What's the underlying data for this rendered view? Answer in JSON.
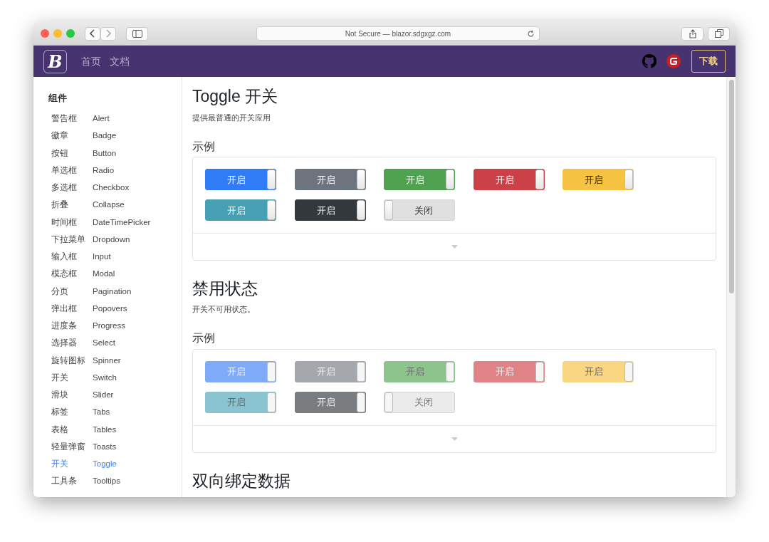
{
  "browser": {
    "address": "Not Secure — blazor.sdgxgz.com"
  },
  "navbar": {
    "logo": "B",
    "links": [
      "首页",
      "文档"
    ],
    "download": "下载"
  },
  "sidebar": {
    "heading": "组件",
    "items": [
      {
        "zh": "警告框",
        "en": "Alert",
        "selected": false
      },
      {
        "zh": "徽章",
        "en": "Badge",
        "selected": false
      },
      {
        "zh": "按钮",
        "en": "Button",
        "selected": false
      },
      {
        "zh": "单选框",
        "en": "Radio",
        "selected": false
      },
      {
        "zh": "多选框",
        "en": "Checkbox",
        "selected": false
      },
      {
        "zh": "折叠",
        "en": "Collapse",
        "selected": false
      },
      {
        "zh": "时间框",
        "en": "DateTimePicker",
        "selected": false
      },
      {
        "zh": "下拉菜单",
        "en": "Dropdown",
        "selected": false
      },
      {
        "zh": "输入框",
        "en": "Input",
        "selected": false
      },
      {
        "zh": "模态框",
        "en": "Modal",
        "selected": false
      },
      {
        "zh": "分页",
        "en": "Pagination",
        "selected": false
      },
      {
        "zh": "弹出框",
        "en": "Popovers",
        "selected": false
      },
      {
        "zh": "进度条",
        "en": "Progress",
        "selected": false
      },
      {
        "zh": "选择器",
        "en": "Select",
        "selected": false
      },
      {
        "zh": "旋转图标",
        "en": "Spinner",
        "selected": false
      },
      {
        "zh": "开关",
        "en": "Switch",
        "selected": false
      },
      {
        "zh": "滑块",
        "en": "Slider",
        "selected": false
      },
      {
        "zh": "标签",
        "en": "Tabs",
        "selected": false
      },
      {
        "zh": "表格",
        "en": "Tables",
        "selected": false
      },
      {
        "zh": "轻量弹窗",
        "en": "Toasts",
        "selected": false
      },
      {
        "zh": "开关",
        "en": "Toggle",
        "selected": true
      },
      {
        "zh": "工具条",
        "en": "Tooltips",
        "selected": false
      }
    ]
  },
  "page": {
    "title": "Toggle 开关",
    "description": "提供最普通的开关应用"
  },
  "sections": [
    {
      "example_label": "示例",
      "toggles": [
        {
          "label": "开启",
          "on": true,
          "disabled": false,
          "color": "#307bf6"
        },
        {
          "label": "开启",
          "on": true,
          "disabled": false,
          "color": "#6c757d"
        },
        {
          "label": "开启",
          "on": true,
          "disabled": false,
          "color": "#4fa24f"
        },
        {
          "label": "开启",
          "on": true,
          "disabled": false,
          "color": "#cc4148"
        },
        {
          "label": "开启",
          "on": true,
          "disabled": false,
          "color": "#f5c242"
        },
        {
          "label": "开启",
          "on": true,
          "disabled": false,
          "color": "#47a0b4"
        },
        {
          "label": "开启",
          "on": true,
          "disabled": false,
          "color": "#33383c"
        },
        {
          "label": "关闭",
          "on": false,
          "disabled": false
        }
      ]
    },
    {
      "title": "禁用状态",
      "description": "开关不可用状态。",
      "example_label": "示例",
      "toggles": [
        {
          "label": "开启",
          "on": true,
          "disabled": true,
          "color": "#7eaaf8"
        },
        {
          "label": "开启",
          "on": true,
          "disabled": true,
          "color": "#a4a7ab"
        },
        {
          "label": "开启",
          "on": true,
          "disabled": true,
          "color": "#8dc38d"
        },
        {
          "label": "开启",
          "on": true,
          "disabled": true,
          "color": "#e08386"
        },
        {
          "label": "开启",
          "on": true,
          "disabled": true,
          "color": "#f8d682"
        },
        {
          "label": "开启",
          "on": true,
          "disabled": true,
          "color": "#8ac4d1"
        },
        {
          "label": "开启",
          "on": true,
          "disabled": true,
          "color": "#7a7d80"
        },
        {
          "label": "关闭",
          "on": false,
          "disabled": true
        }
      ]
    }
  ],
  "next_heading": "双向绑定数据"
}
